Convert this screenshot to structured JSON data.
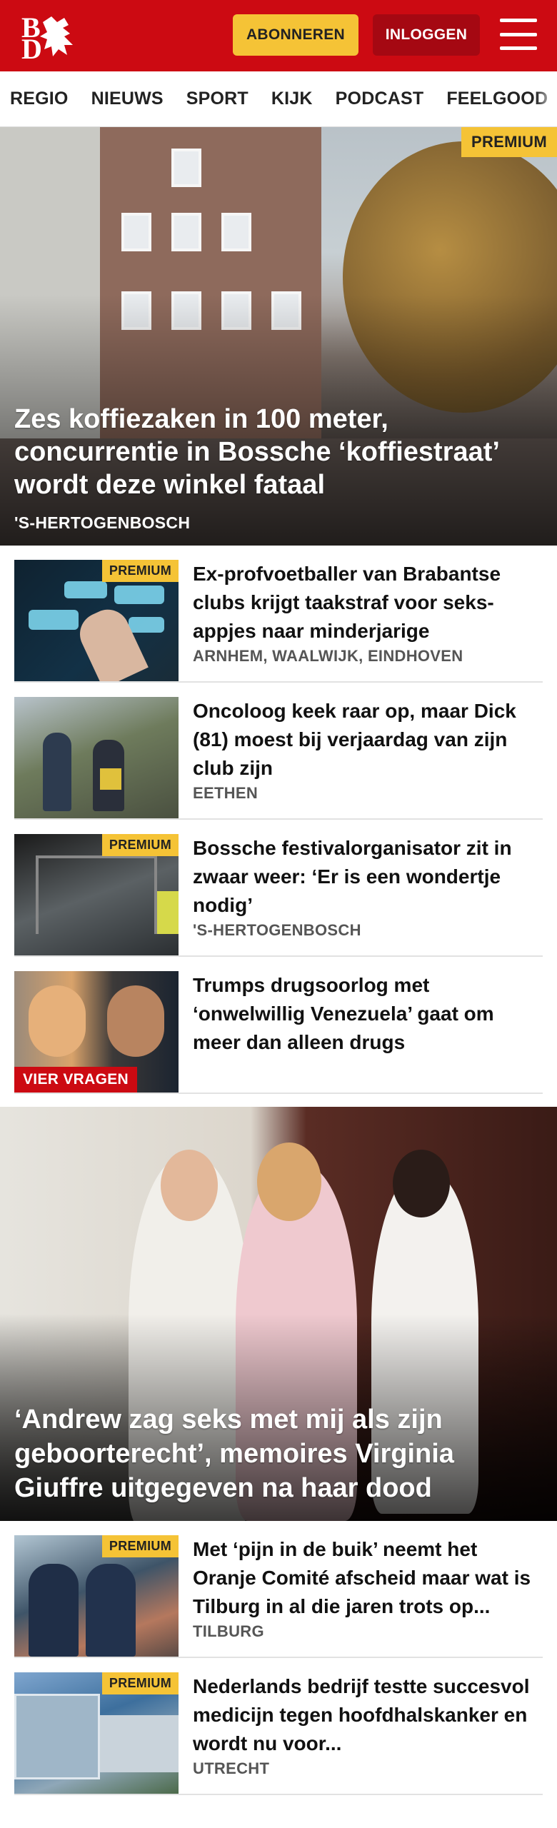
{
  "header": {
    "logo_b": "B",
    "logo_d": "D",
    "subscribe_label": "ABONNEREN",
    "login_label": "INLOGGEN"
  },
  "nav": {
    "items": [
      "REGIO",
      "NIEUWS",
      "SPORT",
      "KIJK",
      "PODCAST",
      "FEELGOOD"
    ]
  },
  "hero": {
    "badge": "PREMIUM",
    "title": "Zes koffiezaken in 100 meter, concurrentie in Bossche ‘koffiestraat’ wordt deze winkel fataal",
    "location": "'S-HERTOGENBOSCH"
  },
  "articles": [
    {
      "badge": "PREMIUM",
      "title": "Ex-profvoetballer van Brabantse clubs krijgt taakstraf voor seks­appjes naar minderjarige",
      "location": "ARNHEM, WAALWIJK, EINDHOVEN"
    },
    {
      "title": "Oncoloog keek raar op, maar Dick (81) moest bij verjaardag van zijn club zijn",
      "location": "EETHEN"
    },
    {
      "badge": "PREMIUM",
      "title": "Bossche festivalorganisator zit in zwaar weer: ‘Er is een wondertje nodig’",
      "location": "'S-HERTOGENBOSCH"
    },
    {
      "label": "VIER VRAGEN",
      "title": "Trumps drugsoorlog met ‘onwelwillig Venezuela’ gaat om meer dan alleen drugs"
    }
  ],
  "hero2": {
    "title": "‘Andrew zag seks met mij als zijn geboorterecht’, memoires Virginia Giuffre uitgegeven na haar dood"
  },
  "articles2": [
    {
      "badge": "PREMIUM",
      "title": "Met ‘pijn in de buik’ neemt het Oranje Comité afscheid maar wat is Tilburg in al die jaren trots op...",
      "location": "TILBURG"
    },
    {
      "badge": "PREMIUM",
      "title": "Nederlands bedrijf testte succesvol medicijn tegen hoofd­halskanker en wordt nu voor...",
      "location": "UTRECHT"
    }
  ],
  "colors": {
    "brand_red": "#cc0a12",
    "premium_yellow": "#f5c336",
    "login_dark_red": "#a50812"
  }
}
